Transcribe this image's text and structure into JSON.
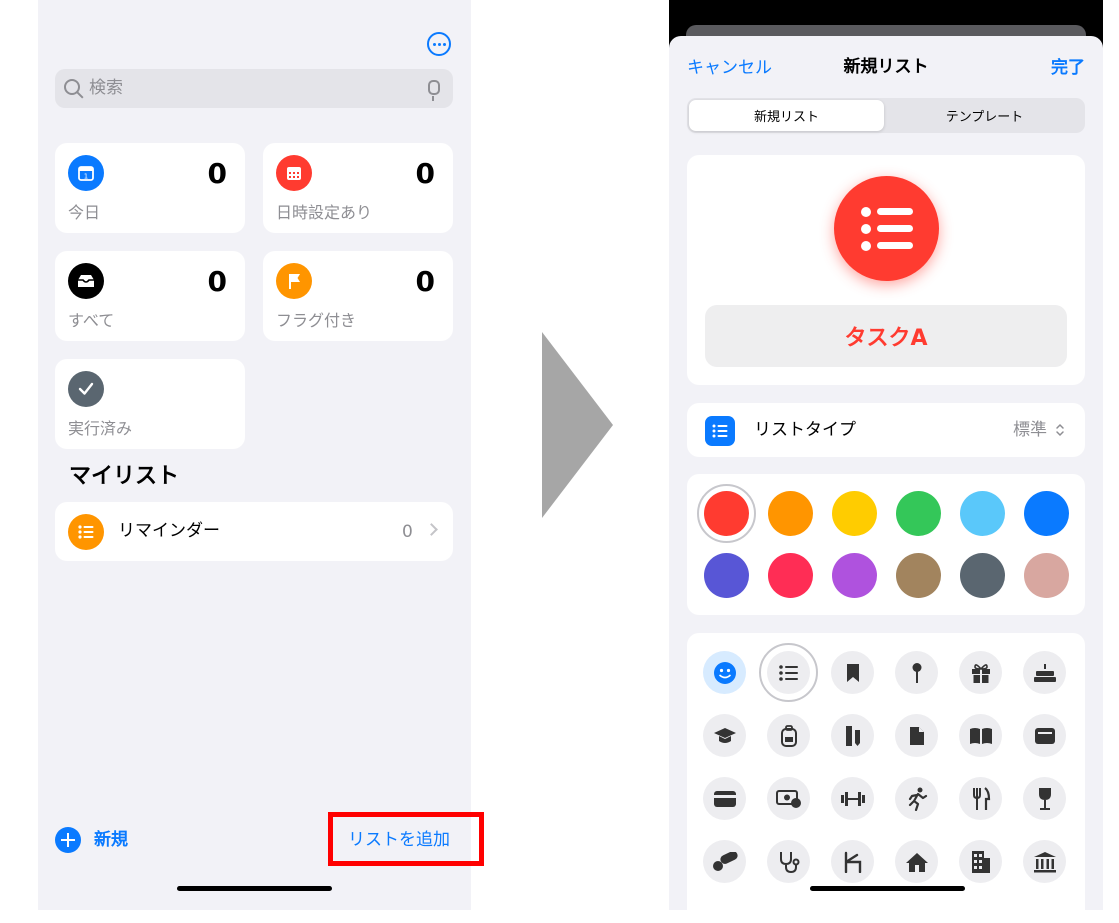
{
  "left": {
    "search": {
      "placeholder": "検索"
    },
    "smart_lists": [
      {
        "label": "今日",
        "count": "0",
        "icon": "calendar-today-icon",
        "color": "#0a7aff"
      },
      {
        "label": "日時設定あり",
        "count": "0",
        "icon": "calendar-grid-icon",
        "color": "#ff3b30"
      },
      {
        "label": "すべて",
        "count": "0",
        "icon": "tray-icon",
        "color": "#000000"
      },
      {
        "label": "フラグ付き",
        "count": "0",
        "icon": "flag-icon",
        "color": "#ff9500"
      },
      {
        "label": "実行済み",
        "count": "",
        "icon": "checkmark-icon",
        "color": "#5a6670"
      }
    ],
    "my_lists_title": "マイリスト",
    "my_lists": [
      {
        "name": "リマインダー",
        "count": "0",
        "icon": "list-bullet-icon",
        "color": "#ff9500"
      }
    ],
    "toolbar": {
      "new_label": "新規",
      "add_list_label": "リストを追加"
    }
  },
  "right": {
    "nav": {
      "cancel": "キャンセル",
      "title": "新規リスト",
      "done": "完了"
    },
    "segments": [
      "新規リスト",
      "テンプレート"
    ],
    "list_name": "タスクA",
    "list_type": {
      "label": "リストタイプ",
      "value": "標準"
    },
    "accent": "#ff3b30",
    "colors": [
      "#ff3b30",
      "#ff9500",
      "#ffcc00",
      "#34c759",
      "#5ac8fa",
      "#0a7aff",
      "#5856d6",
      "#ff2d55",
      "#af52de",
      "#a2845e",
      "#5a6670",
      "#d8a7a0"
    ],
    "selected_color_index": 0,
    "glyphs": [
      "smiley-icon",
      "list-bullet-icon",
      "bookmark-icon",
      "pin-icon",
      "gift-icon",
      "birthday-cake-icon",
      "graduation-cap-icon",
      "backpack-icon",
      "ruler-pencil-icon",
      "document-icon",
      "book-icon",
      "wallet-icon",
      "credit-card-icon",
      "money-icon",
      "dumbbell-icon",
      "running-figure-icon",
      "fork-knife-icon",
      "wine-glass-icon",
      "pills-icon",
      "stethoscope-icon",
      "chair-icon",
      "house-icon",
      "office-building-icon",
      "bank-icon"
    ],
    "selected_glyph_index": 1
  }
}
